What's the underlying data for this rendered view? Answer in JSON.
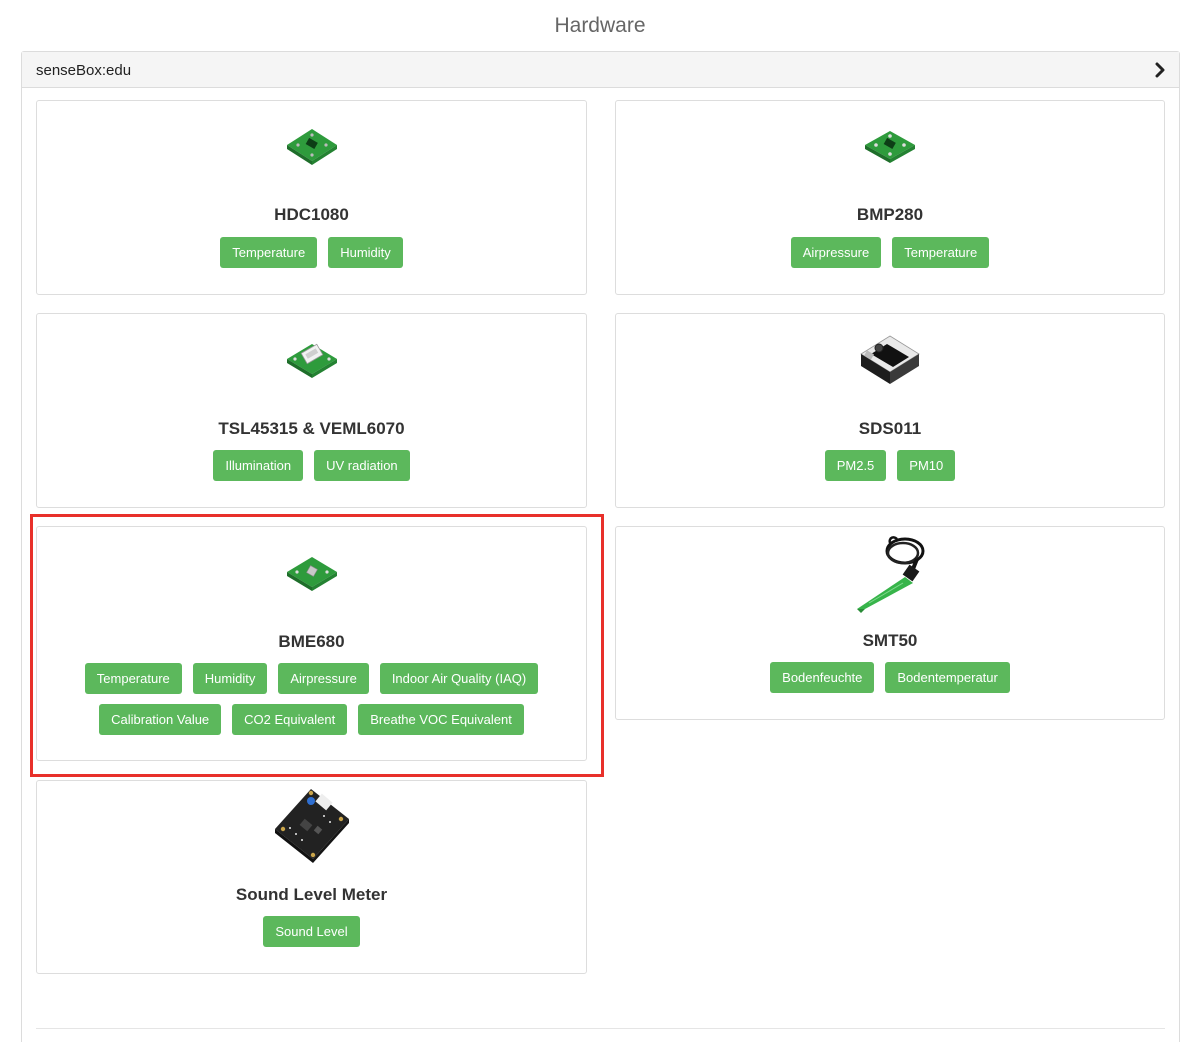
{
  "page": {
    "title": "Hardware"
  },
  "panel": {
    "title": "senseBox:edu",
    "toggle_icon": "chevron-right-icon"
  },
  "cards": [
    {
      "title": "HDC1080",
      "icon": "green-sensor-board",
      "tags": [
        "Temperature",
        "Humidity"
      ]
    },
    {
      "title": "BMP280",
      "icon": "green-sensor-board",
      "tags": [
        "Airpressure",
        "Temperature"
      ]
    },
    {
      "title": "TSL45315 & VEML6070",
      "icon": "green-sensor-board-with-connector",
      "tags": [
        "Illumination",
        "UV radiation"
      ]
    },
    {
      "title": "SDS011",
      "icon": "black-particle-sensor",
      "tags": [
        "PM2.5",
        "PM10"
      ]
    },
    {
      "title": "BME680",
      "icon": "green-sensor-board",
      "tags": [
        "Temperature",
        "Humidity",
        "Airpressure",
        "Indoor Air Quality (IAQ)",
        "Calibration Value",
        "CO2 Equivalent",
        "Breathe VOC Equivalent"
      ]
    },
    {
      "title": "SMT50",
      "icon": "soil-moisture-probe",
      "tags": [
        "Bodenfeuchte",
        "Bodentemperatur"
      ]
    },
    {
      "title": "Sound Level Meter",
      "icon": "sound-level-board",
      "tags": [
        "Sound Level"
      ]
    }
  ],
  "colors": {
    "tag_bg": "#5cb85c",
    "highlight": "#e8302a"
  }
}
